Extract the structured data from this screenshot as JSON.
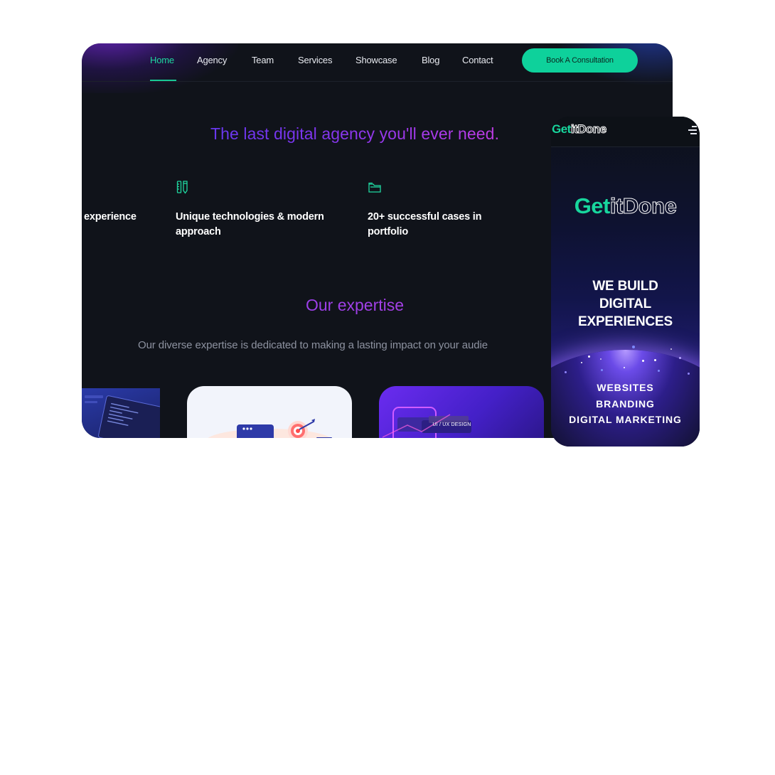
{
  "desktop": {
    "nav": {
      "items": [
        "Home",
        "Agency",
        "Team",
        "Services",
        "Showcase",
        "Blog",
        "Contact"
      ],
      "active": "Home",
      "cta_label": "Book A Consultation"
    },
    "headline": "The last digital agency you'll ever need.",
    "features": [
      {
        "icon": "experience-icon",
        "text": "experience"
      },
      {
        "icon": "pencil-ruler-icon",
        "text": "Unique technologies & modern approach"
      },
      {
        "icon": "folder-icon",
        "text": "20+ successful cases in portfolio"
      }
    ],
    "expertise": {
      "title": "Our expertise",
      "subtitle": "Our diverse expertise is dedicated to making a lasting impact on your audie"
    },
    "cards": [
      {
        "name": "code-screen-card"
      },
      {
        "name": "marketing-target-card"
      },
      {
        "name": "ui-ux-design-card",
        "tag": "UI / UX DESIGN"
      }
    ]
  },
  "mobile": {
    "logo": {
      "part1": "Get",
      "part2": "itDone"
    },
    "hero": [
      "WE BUILD",
      "DIGITAL",
      "EXPERIENCES"
    ],
    "services": [
      "WEBSITES",
      "BRANDING",
      "DIGITAL MARKETING"
    ]
  },
  "colors": {
    "accent": "#0ed19b",
    "background": "#10131a",
    "gradient_start": "#4f3cf0",
    "gradient_end": "#e640c2"
  }
}
